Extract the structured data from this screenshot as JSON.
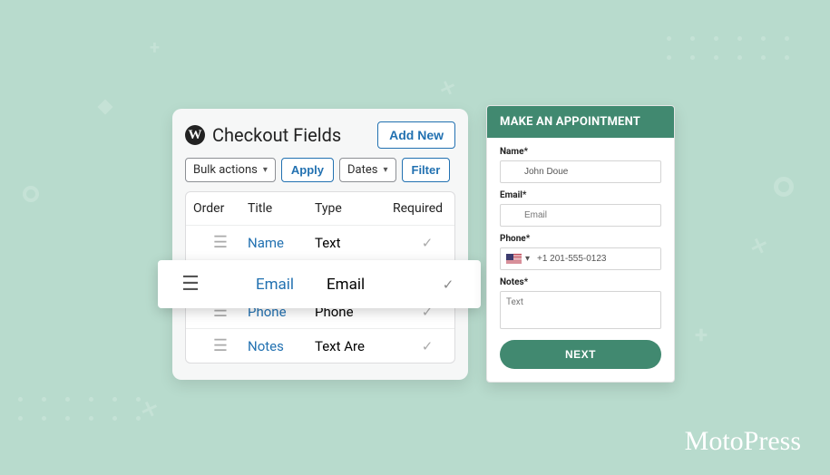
{
  "brand": "MotoPress",
  "admin": {
    "title": "Checkout Fields",
    "add_new": "Add New",
    "bulk_actions": "Bulk actions",
    "apply": "Apply",
    "dates": "Dates",
    "filter": "Filter",
    "columns": {
      "order": "Order",
      "title": "Title",
      "type": "Type",
      "required": "Required"
    },
    "rows": [
      {
        "title": "Name",
        "type": "Text",
        "required": "✓"
      },
      {
        "title": "Email",
        "type": "Email",
        "required": "✓"
      },
      {
        "title": "Phone",
        "type": "Phone",
        "required": "✓"
      },
      {
        "title": "Notes",
        "type": "Text Are",
        "required": "✓"
      }
    ],
    "highlight": {
      "title": "Email",
      "type": "Email",
      "required": "✓"
    }
  },
  "form": {
    "header": "MAKE AN APPOINTMENT",
    "name_label": "Name*",
    "name_value": "John Doue",
    "email_label": "Email*",
    "email_placeholder": "Email",
    "phone_label": "Phone*",
    "phone_value": "+1 201-555-0123",
    "notes_label": "Notes*",
    "notes_value": "Text",
    "next": "NEXT"
  }
}
